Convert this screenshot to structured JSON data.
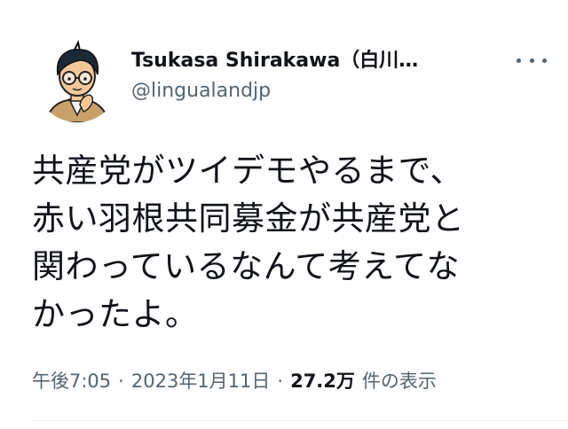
{
  "author": {
    "display_name": "Tsukasa Shirakawa（白川…",
    "handle": "@lingualandjp",
    "avatar_icon": "cartoon-avatar-icon"
  },
  "more_icon": "more-horizontal-icon",
  "tweet": {
    "lines": [
      "共産党がツイデモやるまで、",
      "赤い羽根共同募金が共産党と",
      "関わっているなんて考えてな",
      "かったよ。"
    ]
  },
  "meta": {
    "time": "午後7:05",
    "separator": "·",
    "date": "2023年1月11日",
    "views_count": "27.2万",
    "views_label": "件の表示"
  },
  "colors": {
    "text_primary": "#0f1419",
    "text_secondary": "#536471",
    "divider": "#eff3f4"
  }
}
